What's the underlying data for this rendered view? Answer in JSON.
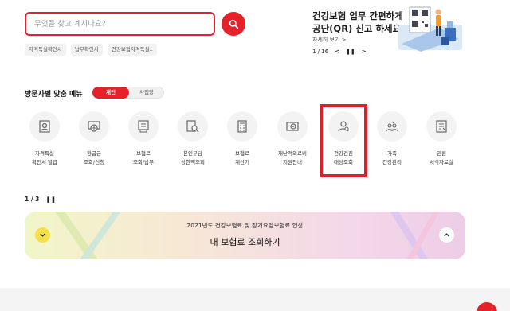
{
  "search": {
    "placeholder": "무엇을 찾고 계시나요?"
  },
  "quick_links": [
    {
      "label": "자격득실확인서"
    },
    {
      "label": "납부확인서"
    },
    {
      "label": "건강보험자격득실.."
    }
  ],
  "banner": {
    "line1": "건강보험 업무 간편하게",
    "line2": "공단(QR) 신고 하세요!",
    "more": "자세히 보기 >",
    "page": "1 / 16"
  },
  "menu_section": {
    "title": "방문자별 맞춤 메뉴",
    "toggle_personal": "개인",
    "toggle_business": "사업장",
    "items": [
      {
        "label": "자격득실\n확인서 발급",
        "icon": "certificate-icon"
      },
      {
        "label": "환급금\n조회/신청",
        "icon": "refund-icon"
      },
      {
        "label": "보험료\n조회/납부",
        "icon": "payment-icon"
      },
      {
        "label": "본인부담\n상한액조회",
        "icon": "search-document-icon"
      },
      {
        "label": "보험료\n계산기",
        "icon": "calculator-icon"
      },
      {
        "label": "재난적의료비\n지원안내",
        "icon": "medical-support-icon"
      },
      {
        "label": "건강검진\n대상조회",
        "icon": "person-search-icon"
      },
      {
        "label": "가족\n건강관리",
        "icon": "family-icon"
      },
      {
        "label": "민원\n서식자료실",
        "icon": "form-document-icon"
      }
    ]
  },
  "promo": {
    "page": "1 / 3",
    "subtitle": "2021년도 건강보험료 및 장기요양보험료 인상",
    "title": "내 보험료 조회하기"
  },
  "colors": {
    "accent": "#e5222a"
  }
}
